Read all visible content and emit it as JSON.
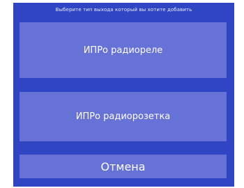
{
  "dialog": {
    "title": "Выберите тип выхода который вы хотите добавить",
    "options": [
      {
        "label": "ИПРо радиореле"
      },
      {
        "label": "ИПРо радиорозетка"
      }
    ],
    "cancel_label": "Отмена",
    "colors": {
      "background": "#2f45c4",
      "button": "#6672d6",
      "text": "#ffffff"
    }
  }
}
